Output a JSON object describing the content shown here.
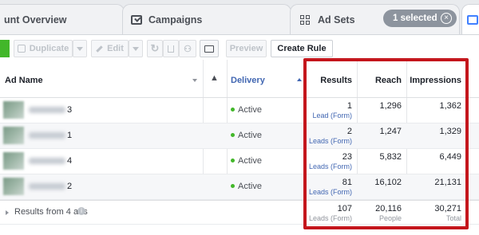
{
  "tabs": {
    "account_overview": "unt Overview",
    "campaigns": "Campaigns",
    "ad_sets": "Ad Sets",
    "selected_pill": "1 selected"
  },
  "toolbar": {
    "duplicate": "Duplicate",
    "edit": "Edit",
    "preview": "Preview",
    "create_rule": "Create Rule"
  },
  "columns": {
    "ad_name": "Ad Name",
    "delivery": "Delivery",
    "results": "Results",
    "reach": "Reach",
    "impressions": "Impressions"
  },
  "rows": [
    {
      "name_suffix": "3",
      "delivery": "Active",
      "results": "1",
      "result_type": "Lead (Form)",
      "reach": "1,296",
      "impressions": "1,362"
    },
    {
      "name_suffix": "1",
      "delivery": "Active",
      "results": "2",
      "result_type": "Leads (Form)",
      "reach": "1,247",
      "impressions": "1,329"
    },
    {
      "name_suffix": "4",
      "delivery": "Active",
      "results": "23",
      "result_type": "Leads (Form)",
      "reach": "5,832",
      "impressions": "6,449"
    },
    {
      "name_suffix": "2",
      "delivery": "Active",
      "results": "81",
      "result_type": "Leads (Form)",
      "reach": "16,102",
      "impressions": "21,131"
    }
  ],
  "totals": {
    "label": "Results from 4 ads",
    "results": "107",
    "results_sub": "Leads (Form)",
    "reach": "20,116",
    "reach_sub": "People",
    "impressions": "30,271",
    "impressions_sub": "Total"
  },
  "colors": {
    "highlight": "#c4161c",
    "active_dot": "#42b72a",
    "link_blue": "#4267b2"
  }
}
